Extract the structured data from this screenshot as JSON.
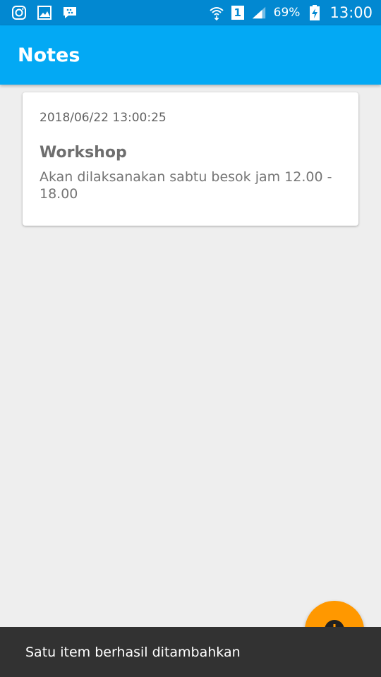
{
  "status_bar": {
    "left_icons": [
      "instagram-icon",
      "gallery-icon",
      "bbm-chat-icon"
    ],
    "right_icons": [
      "wifi-icon",
      "sim-1-icon",
      "signal-icon",
      "battery-charging-icon"
    ],
    "battery": "69%",
    "time": "13:00",
    "sim_number": "1"
  },
  "app_bar": {
    "title": "Notes"
  },
  "notes": [
    {
      "date": "2018/06/22 13:00:25",
      "title": "Workshop",
      "description": "Akan dilaksanakan sabtu besok jam 12.00 - 18.00"
    }
  ],
  "fab": {
    "icon": "add-icon"
  },
  "snackbar": {
    "message": "Satu item berhasil ditambahkan"
  },
  "colors": {
    "status_bar": "#0288d1",
    "app_bar": "#03a9f4",
    "fab": "#ff9800",
    "snackbar": "#323232",
    "background": "#eeeeee"
  }
}
